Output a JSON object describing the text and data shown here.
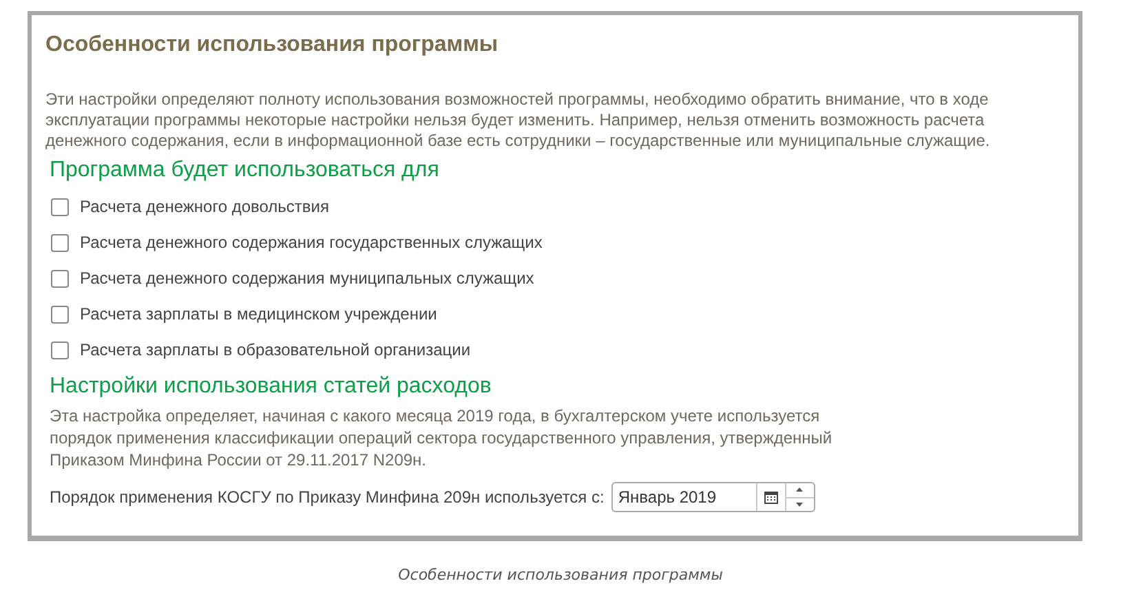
{
  "window": {
    "title": "Особенности использования программы"
  },
  "description": [
    "Эти настройки определяют полноту использования возможностей программы, необходимо обратить внимание, что в ходе",
    "эксплуатации программы некоторые настройки нельзя будет изменить. Например, нельзя отменить возможность расчета",
    "денежного содержания, если в информационной базе есть сотрудники – государственные или муниципальные служащие."
  ],
  "usage_section": {
    "title": "Программа будет использоваться для",
    "options": [
      {
        "label": "Расчета денежного довольствия",
        "checked": false
      },
      {
        "label": "Расчета денежного содержания государственных служащих",
        "checked": false
      },
      {
        "label": "Расчета денежного содержания муниципальных служащих",
        "checked": false
      },
      {
        "label": "Расчета зарплаты в медицинском учреждении",
        "checked": false
      },
      {
        "label": "Расчета зарплаты в образовательной организации",
        "checked": false
      }
    ]
  },
  "expense_section": {
    "title": "Настройки использования статей расходов",
    "note": [
      "Эта настройка определяет, начиная с какого месяца 2019 года, в бухгалтерском учете используется",
      "порядок применения классификации операций сектора государственного управления, утвержденный",
      "Приказом Минфина России от 29.11.2017 N209н."
    ],
    "field_label": "Порядок применения КОСГУ по Приказу Минфина 209н используется с:",
    "field_value": "Январь 2019"
  },
  "caption": "Особенности использования программы"
}
